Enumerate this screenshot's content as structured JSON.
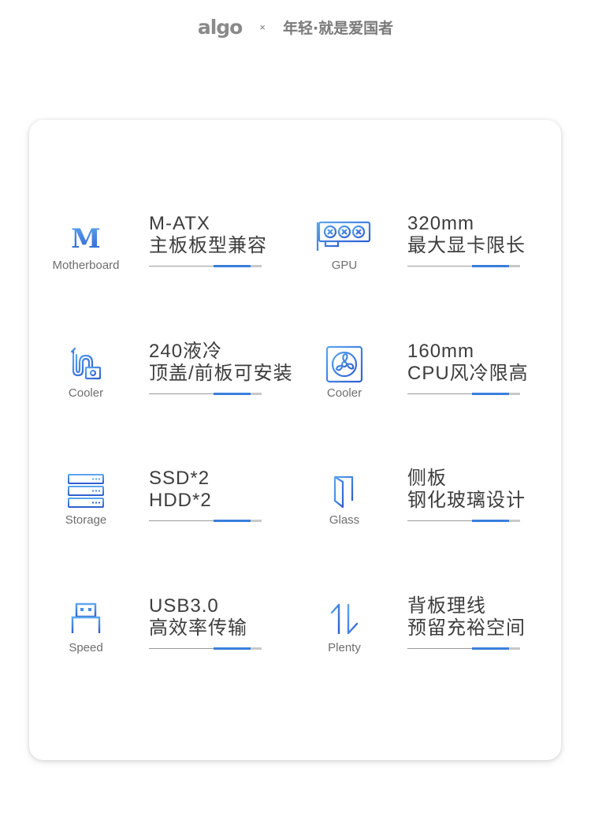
{
  "header": {
    "brand": "algo",
    "separator": "×",
    "slogan": "年轻·就是爱国者"
  },
  "features": [
    {
      "icon": "motherboard-icon",
      "label": "Motherboard",
      "line1": "M-ATX",
      "line2": "主板板型兼容"
    },
    {
      "icon": "gpu-icon",
      "label": "GPU",
      "line1": "320mm",
      "line2": "最大显卡限长"
    },
    {
      "icon": "liquid-cooler-icon",
      "label": "Cooler",
      "line1": "240液冷",
      "line2": "顶盖/前板可安装"
    },
    {
      "icon": "fan-icon",
      "label": "Cooler",
      "line1": "160mm",
      "line2": "CPU风冷限高"
    },
    {
      "icon": "storage-icon",
      "label": "Storage",
      "line1": "SSD*2",
      "line2": "HDD*2"
    },
    {
      "icon": "glass-panel-icon",
      "label": "Glass",
      "line1": "侧板",
      "line2": "钢化玻璃设计"
    },
    {
      "icon": "usb-icon",
      "label": "Speed",
      "line1": "USB3.0",
      "line2": "高效率传输"
    },
    {
      "icon": "cable-management-icon",
      "label": "Plenty",
      "line1": "背板理线",
      "line2": "预留充裕空间"
    }
  ],
  "colors": {
    "accent": "#3a7fdc",
    "icon_light": "#5aa6ef",
    "icon_dark": "#2f5fd0",
    "text": "#3d3d3d",
    "label": "#6e6e6e"
  }
}
